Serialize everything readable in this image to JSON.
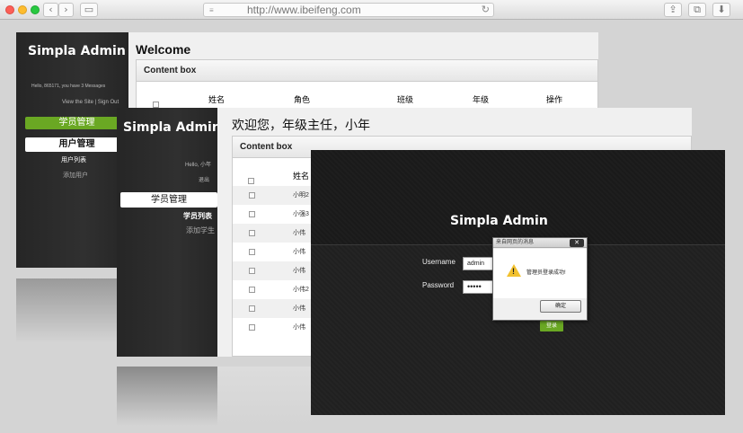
{
  "browser": {
    "url": "http://www.ibeifeng.com",
    "back_glyph": "‹",
    "forward_glyph": "›",
    "sidebar_glyph": "▭",
    "share_glyph": "⇪",
    "tabs_glyph": "⧉",
    "download_glyph": "⬇",
    "reload_glyph": "↻"
  },
  "panel1": {
    "logo": "Simpla Admin",
    "greeting": "Hello, 865171, you have 3 Messages",
    "links": "View the Site | Sign Out",
    "nav": [
      "学员管理",
      "用户管理",
      "用户列表",
      "添加用户"
    ],
    "title": "Welcome",
    "box_title": "Content box",
    "columns": [
      "姓名",
      "角色",
      "班级",
      "年级",
      "操作"
    ]
  },
  "panel2": {
    "logo": "Simpla Admin",
    "greeting": "Hello, 小年",
    "links": "退出",
    "nav": [
      "学员管理",
      "学员列表",
      "添加学生"
    ],
    "title": "欢迎您，年级主任，小年",
    "box_title": "Content box",
    "column": "姓名",
    "rows": [
      "小明2",
      "小强3",
      "小伟",
      "小伟",
      "小伟",
      "小伟2",
      "小伟",
      "小伟"
    ]
  },
  "login": {
    "logo": "Simpla Admin",
    "username_label": "Username",
    "username_value": "admin",
    "password_label": "Password",
    "password_value": "•••••",
    "submit": "登录"
  },
  "dialog": {
    "title": "来自网页的消息",
    "close": "✕",
    "message": "管理员登录成功!",
    "ok": "确定"
  },
  "colors": {
    "accent_green": "#6aa823",
    "sidebar_dark": "#2b2b2b"
  }
}
